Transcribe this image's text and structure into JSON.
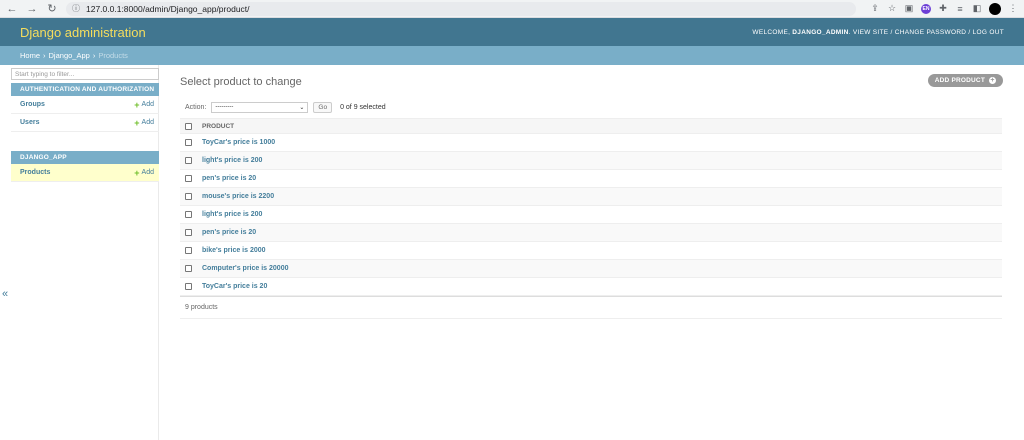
{
  "browser": {
    "url": "127.0.0.1:8000/admin/Django_app/product/",
    "back_icon": "arrow-left-icon",
    "forward_icon": "arrow-right-icon",
    "reload_icon": "reload-icon",
    "ext_badge": "EN"
  },
  "header": {
    "branding": "Django administration",
    "welcome_prefix": "WELCOME, ",
    "username": "DJANGO_ADMIN",
    "welcome_suffix": ". ",
    "view_site": "VIEW SITE",
    "sep": " / ",
    "change_password": "CHANGE PASSWORD",
    "log_out": "LOG OUT"
  },
  "breadcrumbs": {
    "home": "Home",
    "app": "Django_App",
    "current": "Products",
    "separator": "›"
  },
  "sidebar": {
    "filter_placeholder": "Start typing to filter...",
    "toggle_icon": "«",
    "modules": [
      {
        "caption": "AUTHENTICATION AND AUTHORIZATION",
        "models": [
          {
            "name": "Groups",
            "add": "Add"
          },
          {
            "name": "Users",
            "add": "Add"
          }
        ]
      },
      {
        "caption": "DJANGO_APP",
        "models": [
          {
            "name": "Products",
            "add": "Add"
          }
        ]
      }
    ]
  },
  "content": {
    "title": "Select product to change",
    "add_button": "ADD PRODUCT",
    "action_label": "Action:",
    "action_selected": "---------",
    "go_label": "Go",
    "selected_count": "0 of 9 selected",
    "column_header": "PRODUCT",
    "rows": [
      "ToyCar's price is 1000",
      "light's price is 200",
      "pen's price is 20",
      "mouse's price is 2200",
      "light's price is 200",
      "pen's price is 20",
      "bike's price is 2000",
      "Computer's price is 20000",
      "ToyCar's price is 20"
    ],
    "paginator": "9 products"
  },
  "colors": {
    "header_bg": "#417690",
    "branding": "#f5dd5d",
    "breadcrumbs_bg": "#79aec8",
    "link": "#447e9b",
    "add_green": "#70bf2b",
    "current_row": "#ffffcc"
  }
}
